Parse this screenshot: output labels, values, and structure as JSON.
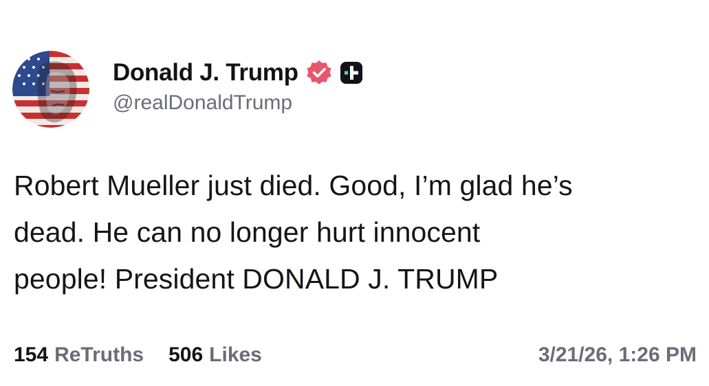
{
  "author": {
    "display_name": "Donald J. Trump",
    "handle": "@realDonaldTrump",
    "avatar_icon": "flag-portrait-avatar",
    "verified_icon": "verified-check-icon",
    "verified_color": "#e9566d",
    "badge_icon": "plus-badge-icon"
  },
  "post": {
    "lines": [
      "Robert Mueller just died. Good, I’m glad he’s",
      "dead. He can no longer hurt innocent",
      "people! President DONALD J. TRUMP"
    ]
  },
  "stats": {
    "retruths_count": "154",
    "retruths_label": "ReTruths",
    "likes_count": "506",
    "likes_label": "Likes"
  },
  "timestamp": "3/21/26, 1:26 PM"
}
